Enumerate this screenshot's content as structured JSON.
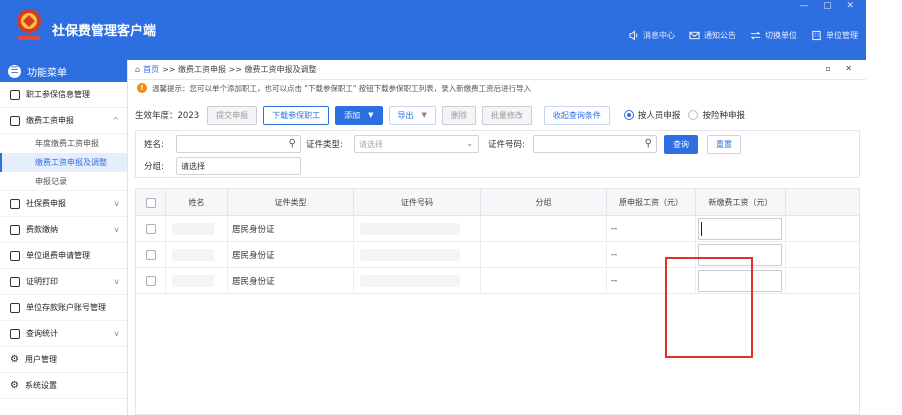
{
  "app": {
    "title": "社保费管理客户端",
    "window_controls": "— ▢ ✕",
    "top_actions": [
      {
        "icon": "speaker-icon",
        "label": "消息中心"
      },
      {
        "icon": "mail-icon",
        "label": "通知公告"
      },
      {
        "icon": "switch-icon",
        "label": "切换单位"
      },
      {
        "icon": "building-icon",
        "label": "单位管理"
      }
    ]
  },
  "sidebar": {
    "header": "功能菜单",
    "items": [
      {
        "label": "职工参保信息管理",
        "icon": "list-icon",
        "chevron": ""
      },
      {
        "label": "缴费工资申报",
        "icon": "edit-icon",
        "chevron": "^"
      },
      {
        "label": "社保费申报",
        "icon": "calendar-icon",
        "chevron": "v"
      },
      {
        "label": "费款缴纳",
        "icon": "wallet-icon",
        "chevron": "v"
      },
      {
        "label": "单位退费申请管理",
        "icon": "refund-icon",
        "chevron": ""
      },
      {
        "label": "证明打印",
        "icon": "print-icon",
        "chevron": "v"
      },
      {
        "label": "单位存款账户账号管理",
        "icon": "account-icon",
        "chevron": ""
      },
      {
        "label": "查询统计",
        "icon": "chart-icon",
        "chevron": "v"
      },
      {
        "label": "用户管理",
        "icon": "gear-icon",
        "chevron": ""
      },
      {
        "label": "系统设置",
        "icon": "gear-icon",
        "chevron": ""
      }
    ],
    "sub_items": [
      "年度缴费工资申报",
      "缴费工资申报及调整",
      "申报记录"
    ]
  },
  "breadcrumb": {
    "home": "首页",
    "path": ">> 缴费工资申报 >> 缴费工资申报及调整",
    "tab_controls": "▫ ✕"
  },
  "tip": "温馨提示：您可以单个添加职工，也可以点击 \"下载参保职工\" 按钮下载参保职工列表，录入新缴费工资后进行导入",
  "toolbar": {
    "year_label": "生效年度：2023",
    "submit": "提交申报",
    "download": "下载参保职工",
    "add": "添加",
    "export": "导出",
    "delete": "删除",
    "batch_edit": "批量修改",
    "collapse": "收起查询条件",
    "radio_person": "按人员申报",
    "radio_insurance": "按险种申报"
  },
  "filters": {
    "name_label": "姓名:",
    "name_value": "",
    "id_type_label": "证件类型:",
    "id_type_placeholder": "请选择",
    "id_no_label": "证件号码:",
    "id_no_value": "",
    "group_label": "分组:",
    "group_value": "请选择",
    "query": "查询",
    "reset": "重置"
  },
  "table": {
    "columns": [
      "姓名",
      "证件类型",
      "证件号码",
      "分组",
      "原申报工资（元）",
      "新缴费工资（元）"
    ],
    "rows": [
      {
        "name": "",
        "id_type": "居民身份证",
        "id_no": "",
        "group": "",
        "old_wage": "--",
        "new_wage": ""
      },
      {
        "name": "",
        "id_type": "居民身份证",
        "id_no": "",
        "group": "",
        "old_wage": "--",
        "new_wage": ""
      },
      {
        "name": "",
        "id_type": "居民身份证",
        "id_no": "",
        "group": "",
        "old_wage": "--",
        "new_wage": ""
      }
    ]
  },
  "colors": {
    "primary": "#2d6fe0",
    "highlight": "#e0322b",
    "tip_icon": "#f08c1a"
  }
}
